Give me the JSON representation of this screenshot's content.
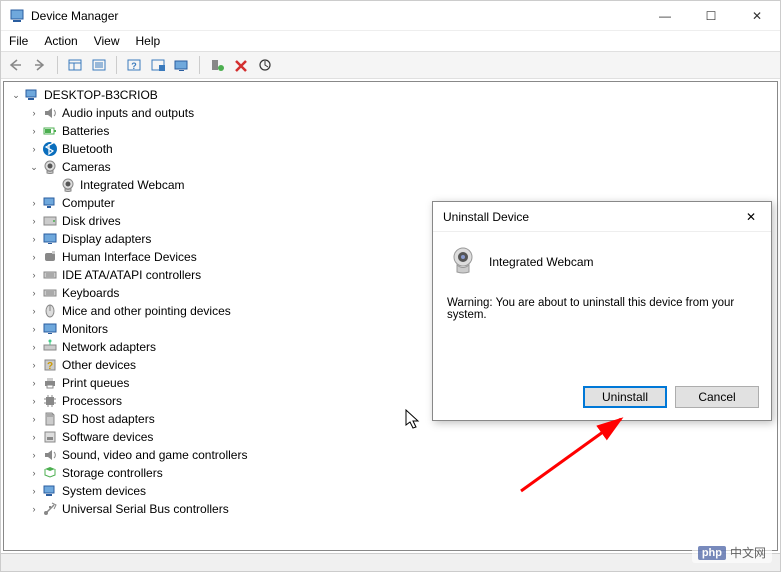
{
  "window": {
    "title": "Device Manager",
    "controls": {
      "min": "—",
      "max": "☐",
      "close": "✕"
    }
  },
  "menu": {
    "file": "File",
    "action": "Action",
    "view": "View",
    "help": "Help"
  },
  "tree": {
    "root": "DESKTOP-B3CRIOB",
    "nodes": [
      {
        "label": "Audio inputs and outputs",
        "icon": "audio"
      },
      {
        "label": "Batteries",
        "icon": "battery"
      },
      {
        "label": "Bluetooth",
        "icon": "bluetooth"
      },
      {
        "label": "Cameras",
        "icon": "camera",
        "expanded": true,
        "children": [
          {
            "label": "Integrated Webcam",
            "icon": "camera"
          }
        ]
      },
      {
        "label": "Computer",
        "icon": "computer"
      },
      {
        "label": "Disk drives",
        "icon": "disk"
      },
      {
        "label": "Display adapters",
        "icon": "display"
      },
      {
        "label": "Human Interface Devices",
        "icon": "hid"
      },
      {
        "label": "IDE ATA/ATAPI controllers",
        "icon": "ide"
      },
      {
        "label": "Keyboards",
        "icon": "keyboard"
      },
      {
        "label": "Mice and other pointing devices",
        "icon": "mouse"
      },
      {
        "label": "Monitors",
        "icon": "monitor"
      },
      {
        "label": "Network adapters",
        "icon": "network"
      },
      {
        "label": "Other devices",
        "icon": "other"
      },
      {
        "label": "Print queues",
        "icon": "printer"
      },
      {
        "label": "Processors",
        "icon": "cpu"
      },
      {
        "label": "SD host adapters",
        "icon": "sd"
      },
      {
        "label": "Software devices",
        "icon": "software"
      },
      {
        "label": "Sound, video and game controllers",
        "icon": "sound"
      },
      {
        "label": "Storage controllers",
        "icon": "storage"
      },
      {
        "label": "System devices",
        "icon": "system"
      },
      {
        "label": "Universal Serial Bus controllers",
        "icon": "usb"
      }
    ]
  },
  "dialog": {
    "title": "Uninstall Device",
    "device": "Integrated Webcam",
    "warning": "Warning: You are about to uninstall this device from your system.",
    "uninstall": "Uninstall",
    "cancel": "Cancel",
    "close": "✕"
  },
  "watermark": {
    "logo": "php",
    "text": "中文网"
  }
}
